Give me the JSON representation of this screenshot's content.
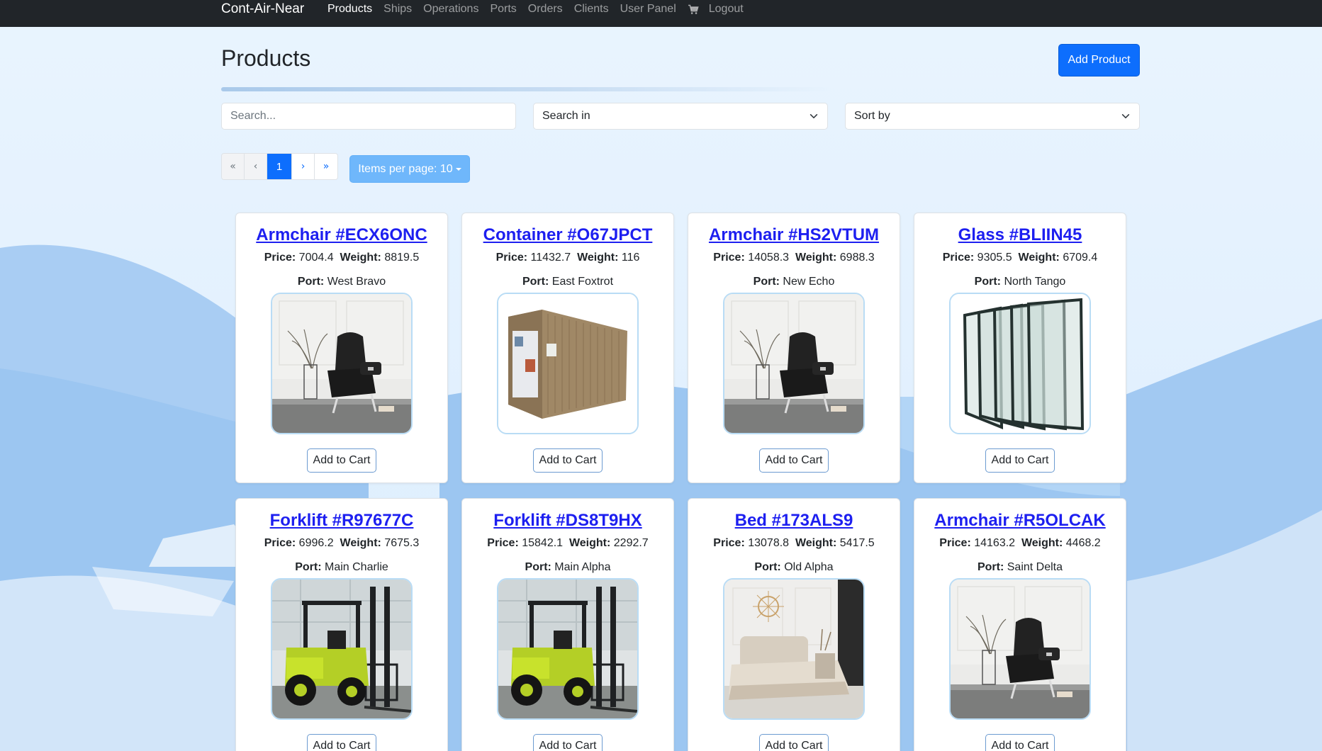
{
  "navbar": {
    "brand": "Cont-Air-Near",
    "links": [
      "Products",
      "Ships",
      "Operations",
      "Ports",
      "Orders",
      "Clients",
      "User Panel"
    ],
    "active": "Products",
    "logout": "Logout"
  },
  "header": {
    "title": "Products",
    "add_button": "Add Product"
  },
  "filters": {
    "search_placeholder": "Search...",
    "search_in": "Search in",
    "sort_by": "Sort by"
  },
  "pagination": {
    "first": "«",
    "prev": "‹",
    "current": "1",
    "next": "›",
    "last": "»",
    "items_per_page": "Items per page: 10"
  },
  "labels": {
    "price": "Price:",
    "weight": "Weight:",
    "port": "Port:",
    "add_to_cart": "Add to Cart"
  },
  "products": [
    {
      "name": "Armchair #ECX6ONC",
      "price": "7004.4",
      "weight": "8819.5",
      "port": "West Bravo",
      "image": "armchair"
    },
    {
      "name": "Container #O67JPCT",
      "price": "11432.7",
      "weight": "116",
      "port": "East Foxtrot",
      "image": "container"
    },
    {
      "name": "Armchair #HS2VTUM",
      "price": "14058.3",
      "weight": "6988.3",
      "port": "New Echo",
      "image": "armchair"
    },
    {
      "name": "Glass #BLIIN45",
      "price": "9305.5",
      "weight": "6709.4",
      "port": "North Tango",
      "image": "glass"
    },
    {
      "name": "Forklift #R97677C",
      "price": "6996.2",
      "weight": "7675.3",
      "port": "Main Charlie",
      "image": "forklift"
    },
    {
      "name": "Forklift #DS8T9HX",
      "price": "15842.1",
      "weight": "2292.7",
      "port": "Main Alpha",
      "image": "forklift"
    },
    {
      "name": "Bed #173ALS9",
      "price": "13078.8",
      "weight": "5417.5",
      "port": "Old Alpha",
      "image": "bed"
    },
    {
      "name": "Armchair #R5OLCAK",
      "price": "14163.2",
      "weight": "4468.2",
      "port": "Saint Delta",
      "image": "armchair"
    }
  ],
  "colors": {
    "navbar": "#212529",
    "primary": "#0d6efd",
    "link": "#1d1ff0",
    "per_page": "#6fb7fb"
  }
}
